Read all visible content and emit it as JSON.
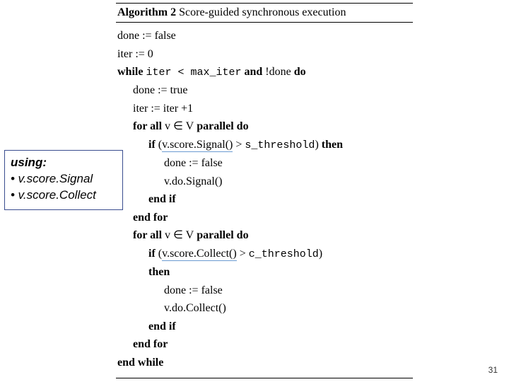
{
  "algorithm": {
    "label": "Algorithm 2",
    "title": "Score-guided synchronous execution",
    "lines": {
      "l0a": "done",
      "l0b": " := ",
      "l0c": "false",
      "l1a": "iter",
      "l1b": " := 0",
      "l2a": "while ",
      "l2b": "iter < max_iter",
      "l2c": " and ",
      "l2d": "!done",
      "l2e": " do",
      "l3": "done := true",
      "l4": "iter := iter +1",
      "l5a": "for all ",
      "l5b": "v ∈ V",
      "l5c": " parallel ",
      "l5d": "do",
      "l6a": "if ",
      "l6b": "(",
      "l6c": "v.score.Signal()",
      "l6d": " > ",
      "l6e": "s_threshold",
      "l6f": ")",
      "l6g": " then",
      "l7": "done := false",
      "l8": "v.do.Signal()",
      "l9": "end if",
      "l10": "end for",
      "l11a": "for all ",
      "l11b": "v ∈ V",
      "l11c": " parallel ",
      "l11d": "do",
      "l12a": "if ",
      "l12b": "(",
      "l12c": "v.score.Collect()",
      "l12d": " > ",
      "l12e": "c_threshold",
      "l12f": ")",
      "l13": "then",
      "l14": "done := false",
      "l15": "v.do.Collect()",
      "l16": "end if",
      "l17": "end for",
      "l18": "end while"
    }
  },
  "callout": {
    "title": "using:",
    "item1": "• v.score.Signal",
    "item2": "• v.score.Collect"
  },
  "page_number": "31"
}
